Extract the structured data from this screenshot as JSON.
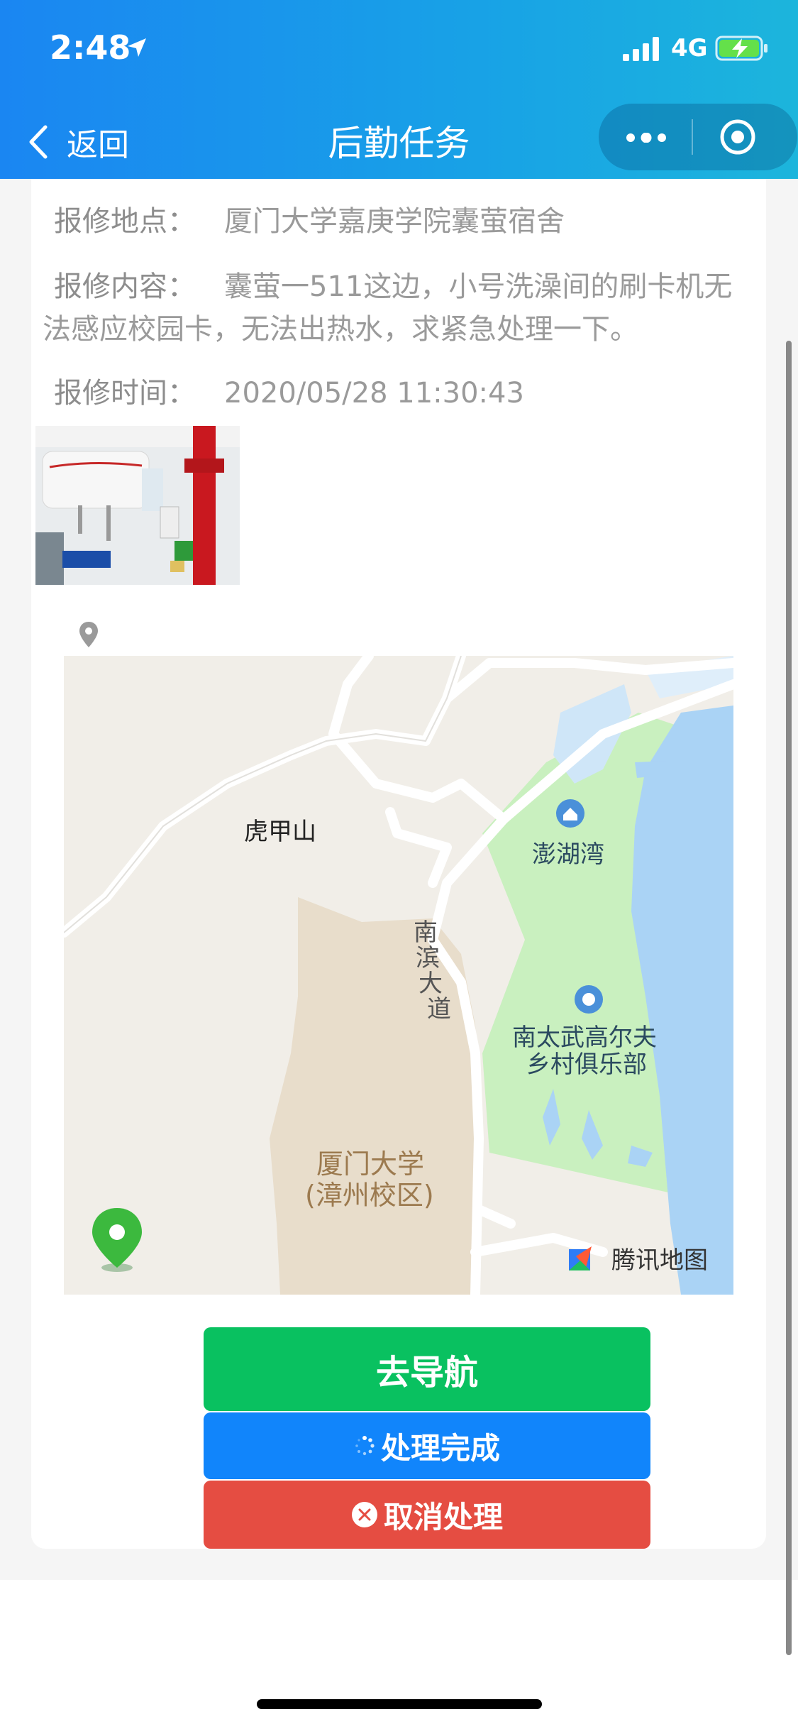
{
  "status_bar": {
    "time": "2:48",
    "network": "4G",
    "location_icon": "location-arrow-icon",
    "signal_icon": "signal-bars-icon",
    "battery_icon": "battery-charging-icon"
  },
  "nav": {
    "back_label": "返回",
    "title": "后勤任务",
    "more_icon": "more-dots-icon",
    "close_icon": "target-circle-icon"
  },
  "repair": {
    "place_label": "报修地点：",
    "place_value": "厦门大学嘉庚学院囊萤宿舍",
    "content_label": "报修内容：",
    "content_value": "囊萤一511这边，小号洗澡间的刷卡机无法感应校园卡，无法出热水，求紧急处理一下。",
    "time_label": "报修时间：",
    "time_value": "2020/05/28 11:30:43"
  },
  "map": {
    "labels": {
      "hujiashan": "虎甲山",
      "penghuwan": "澎湖湾",
      "road_1": "南",
      "road_2": "滨",
      "road_3": "大",
      "road_4": "道",
      "golf_1": "南太武高尔夫",
      "golf_2": "乡村俱乐部",
      "univ_1": "厦门大学",
      "univ_2": "(漳州校区)",
      "brand": "腾讯地图"
    }
  },
  "buttons": {
    "navigate": "去导航",
    "done": "处理完成",
    "cancel": "取消处理"
  },
  "colors": {
    "header_start": "#1a86f2",
    "nav_button": "#09c160",
    "done_button": "#1185fb",
    "cancel_button": "#e54d42"
  }
}
